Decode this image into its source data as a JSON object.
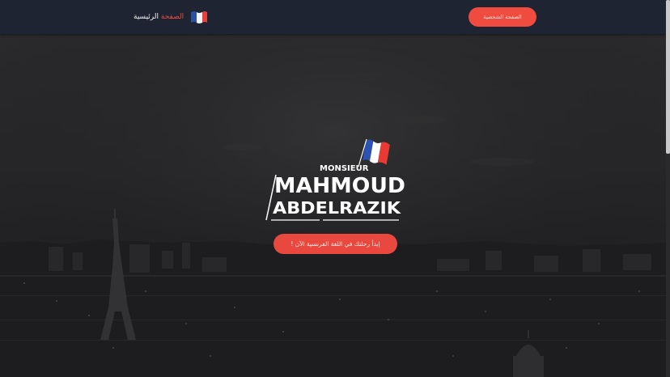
{
  "navbar": {
    "brand_part1": "الصفحة",
    "brand_part2": "الرئيسية",
    "profile_button": "الصفحة الشخصية",
    "flag_icon": "france-flag-icon"
  },
  "logo": {
    "line1": "MONSIEUR",
    "line2": "MAHMOUD",
    "line3": "ABDELRAZIK"
  },
  "hero": {
    "cta_button": "إبدأ رحلتك في اللغة الفرنسية الآن !"
  },
  "colors": {
    "accent": "#ef4b3f",
    "navbar_bg": "#1e2431"
  }
}
